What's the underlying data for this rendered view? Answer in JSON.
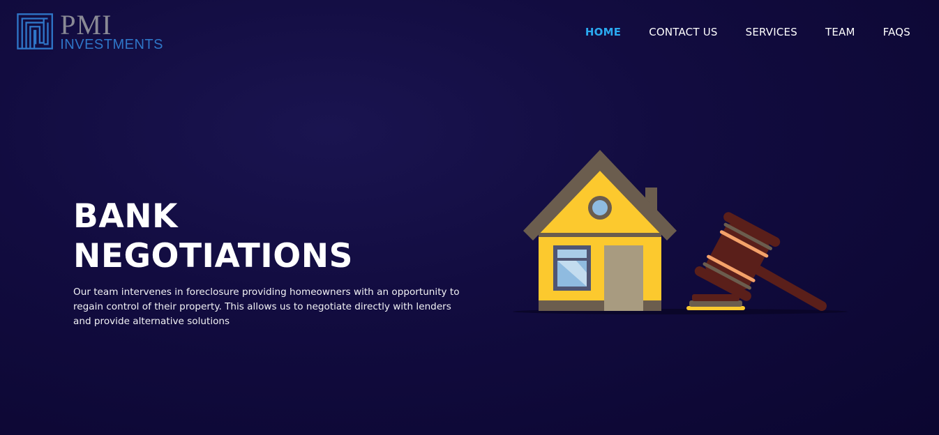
{
  "brand": {
    "name": "PMI",
    "subtitle": "INVESTMENTS",
    "colors": {
      "mark": "#2f76c8",
      "name": "#8a8a95"
    }
  },
  "nav": {
    "items": [
      {
        "label": "HOME",
        "active": true
      },
      {
        "label": "CONTACT US",
        "active": false
      },
      {
        "label": "SERVICES",
        "active": false
      },
      {
        "label": "TEAM",
        "active": false
      },
      {
        "label": "FAQS",
        "active": false
      }
    ],
    "active_color": "#2aa9f0"
  },
  "hero": {
    "title_line1": "BANK",
    "title_line2": "NEGOTIATIONS",
    "description": "Our team intervenes in foreclosure providing homeowners with an opportunity to regain control of their property. This allows us to negotiate directly with lenders and provide alternative solutions"
  },
  "illustration": {
    "icons": [
      "house-icon",
      "gavel-icon"
    ],
    "colors": {
      "house": "#fcc92e",
      "roof": "#6b5d4e",
      "door": "#a89b80",
      "gavel": "#5a1f1a"
    }
  },
  "background_color": "#120c40"
}
